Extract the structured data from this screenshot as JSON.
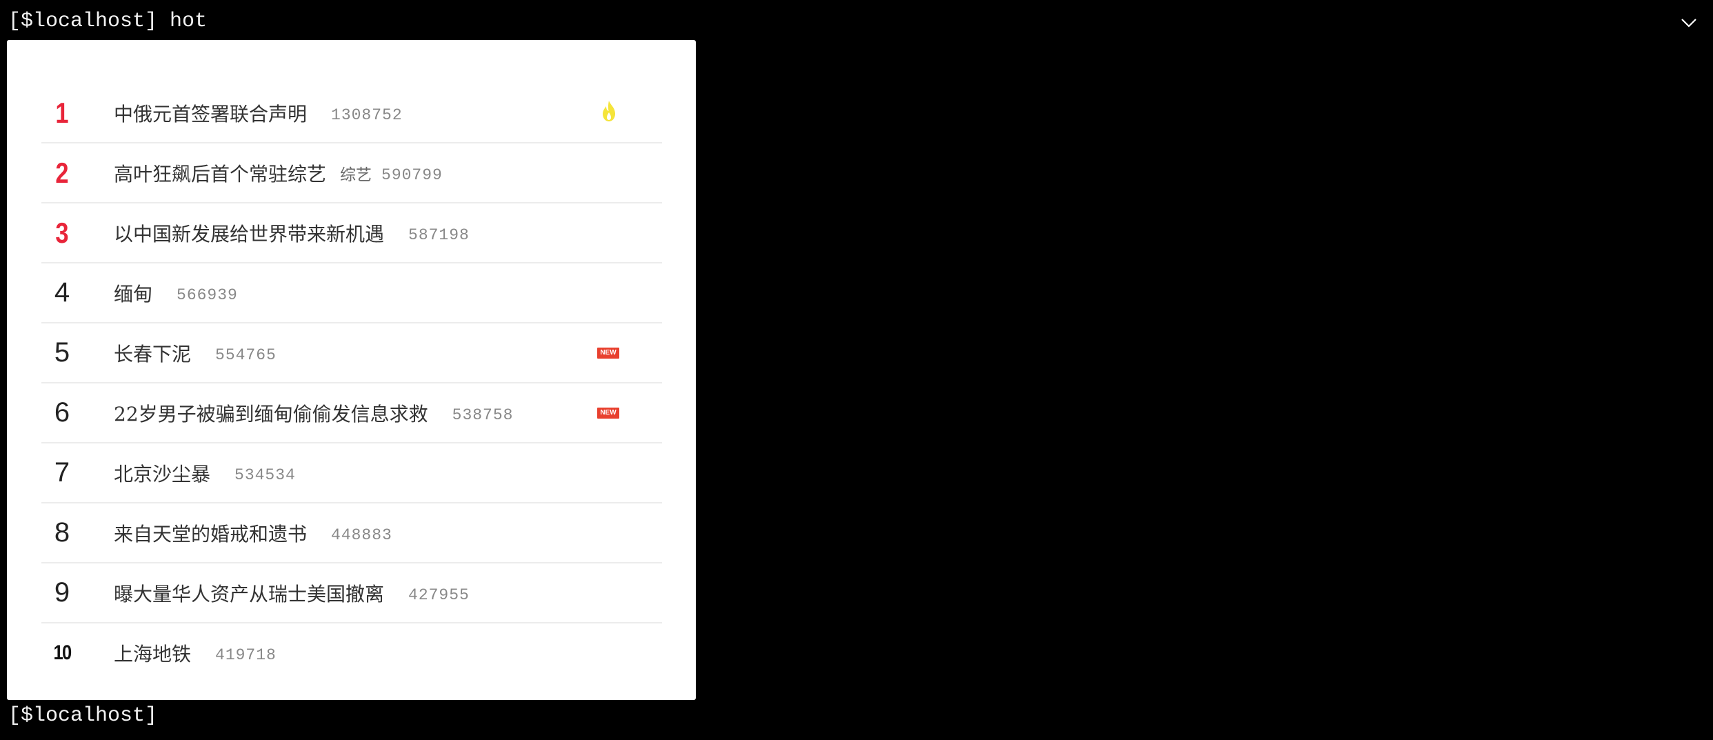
{
  "terminal": {
    "top_prompt": "[$localhost] hot",
    "bottom_prompt": "[$localhost]"
  },
  "icons": {
    "collapse": "chevron-down-icon",
    "hot": "flame-icon"
  },
  "colors": {
    "top_rank": "#e8253a",
    "new_badge": "#e8402e",
    "hot_icon": "#f5e43a"
  },
  "hot_list": {
    "items": [
      {
        "rank": "1",
        "title": "中俄元首签署联合声明",
        "tag": "",
        "count": "1308752",
        "badge": "hot"
      },
      {
        "rank": "2",
        "title": "高叶狂飙后首个常驻综艺",
        "tag": "综艺",
        "count": "590799",
        "badge": ""
      },
      {
        "rank": "3",
        "title": "以中国新发展给世界带来新机遇",
        "tag": "",
        "count": "587198",
        "badge": ""
      },
      {
        "rank": "4",
        "title": "缅甸",
        "tag": "",
        "count": "566939",
        "badge": ""
      },
      {
        "rank": "5",
        "title": "长春下泥",
        "tag": "",
        "count": "554765",
        "badge": "NEW"
      },
      {
        "rank": "6",
        "title": "22岁男子被骗到缅甸偷偷发信息求救",
        "tag": "",
        "count": "538758",
        "badge": "NEW"
      },
      {
        "rank": "7",
        "title": "北京沙尘暴",
        "tag": "",
        "count": "534534",
        "badge": ""
      },
      {
        "rank": "8",
        "title": "来自天堂的婚戒和遗书",
        "tag": "",
        "count": "448883",
        "badge": ""
      },
      {
        "rank": "9",
        "title": "曝大量华人资产从瑞士美国撤离",
        "tag": "",
        "count": "427955",
        "badge": ""
      },
      {
        "rank": "10",
        "title": "上海地铁",
        "tag": "",
        "count": "419718",
        "badge": ""
      }
    ]
  }
}
